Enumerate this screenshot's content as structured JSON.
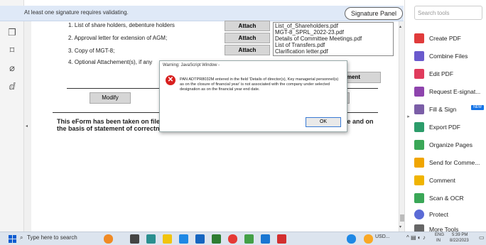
{
  "notification": {
    "message": "At least one signature requires validating.",
    "signature_panel": "Signature Panel"
  },
  "doc": {
    "items": [
      "1. List of share holders, debenture holders",
      "2. Approval letter for extension of AGM;",
      "3. Copy of MGT-8;",
      "4. Optional Attachement(s), if any"
    ],
    "attach_label": "Attach",
    "attachment_button_partial": "hment",
    "files": [
      "List_of_Shareholders.pdf",
      "MGT-8_SPRL_2022-23.pdf",
      "Details of Committee Meetings.pdf",
      "List of Transfers.pdf",
      "Clarification letter.pdf"
    ],
    "modify_label": "Modify",
    "footer_line1": "This eForm has been taken on file m",
    "footer_line1_end": "de and on",
    "footer_line2": "the basis of statement of correctne"
  },
  "dialog": {
    "title": "Warning: JavaScript Window -",
    "message": "PAN ADTPR8032M entered in the field 'Details of director(s), Key managerial personnel(s) as on the closure of financial year' is not associated with the company under selected designation as on the financial year end date.",
    "ok_label": "OK"
  },
  "right_pane": {
    "search_placeholder": "Search tools",
    "new_badge": "NEW",
    "tools": [
      {
        "label": "Create PDF",
        "color": "#e03b3b",
        "icon": "create-pdf-icon"
      },
      {
        "label": "Combine Files",
        "color": "#6a5acd",
        "icon": "combine-files-icon"
      },
      {
        "label": "Edit PDF",
        "color": "#e03b5c",
        "icon": "edit-pdf-icon"
      },
      {
        "label": "Request E-signat...",
        "color": "#8e44ad",
        "icon": "request-esign-icon"
      },
      {
        "label": "Fill & Sign",
        "color": "#7b5ea7",
        "icon": "fill-sign-icon"
      },
      {
        "label": "Export PDF",
        "color": "#2c9c6a",
        "icon": "export-pdf-icon"
      },
      {
        "label": "Organize Pages",
        "color": "#3aa757",
        "icon": "organize-pages-icon"
      },
      {
        "label": "Send for Comme...",
        "color": "#f0a500",
        "icon": "send-comment-icon"
      },
      {
        "label": "Comment",
        "color": "#f0b400",
        "icon": "comment-icon"
      },
      {
        "label": "Scan & OCR",
        "color": "#3aa757",
        "icon": "scan-ocr-icon"
      },
      {
        "label": "Protect",
        "color": "#5b6bd6",
        "icon": "protect-icon"
      },
      {
        "label": "More Tools",
        "color": "#666666",
        "icon": "more-tools-icon"
      }
    ]
  },
  "taskbar": {
    "search_placeholder": "Type here to search",
    "weather": "USD...",
    "lang": "ENG",
    "region": "IN",
    "time": "5:39 PM",
    "date": "8/22/2023"
  }
}
